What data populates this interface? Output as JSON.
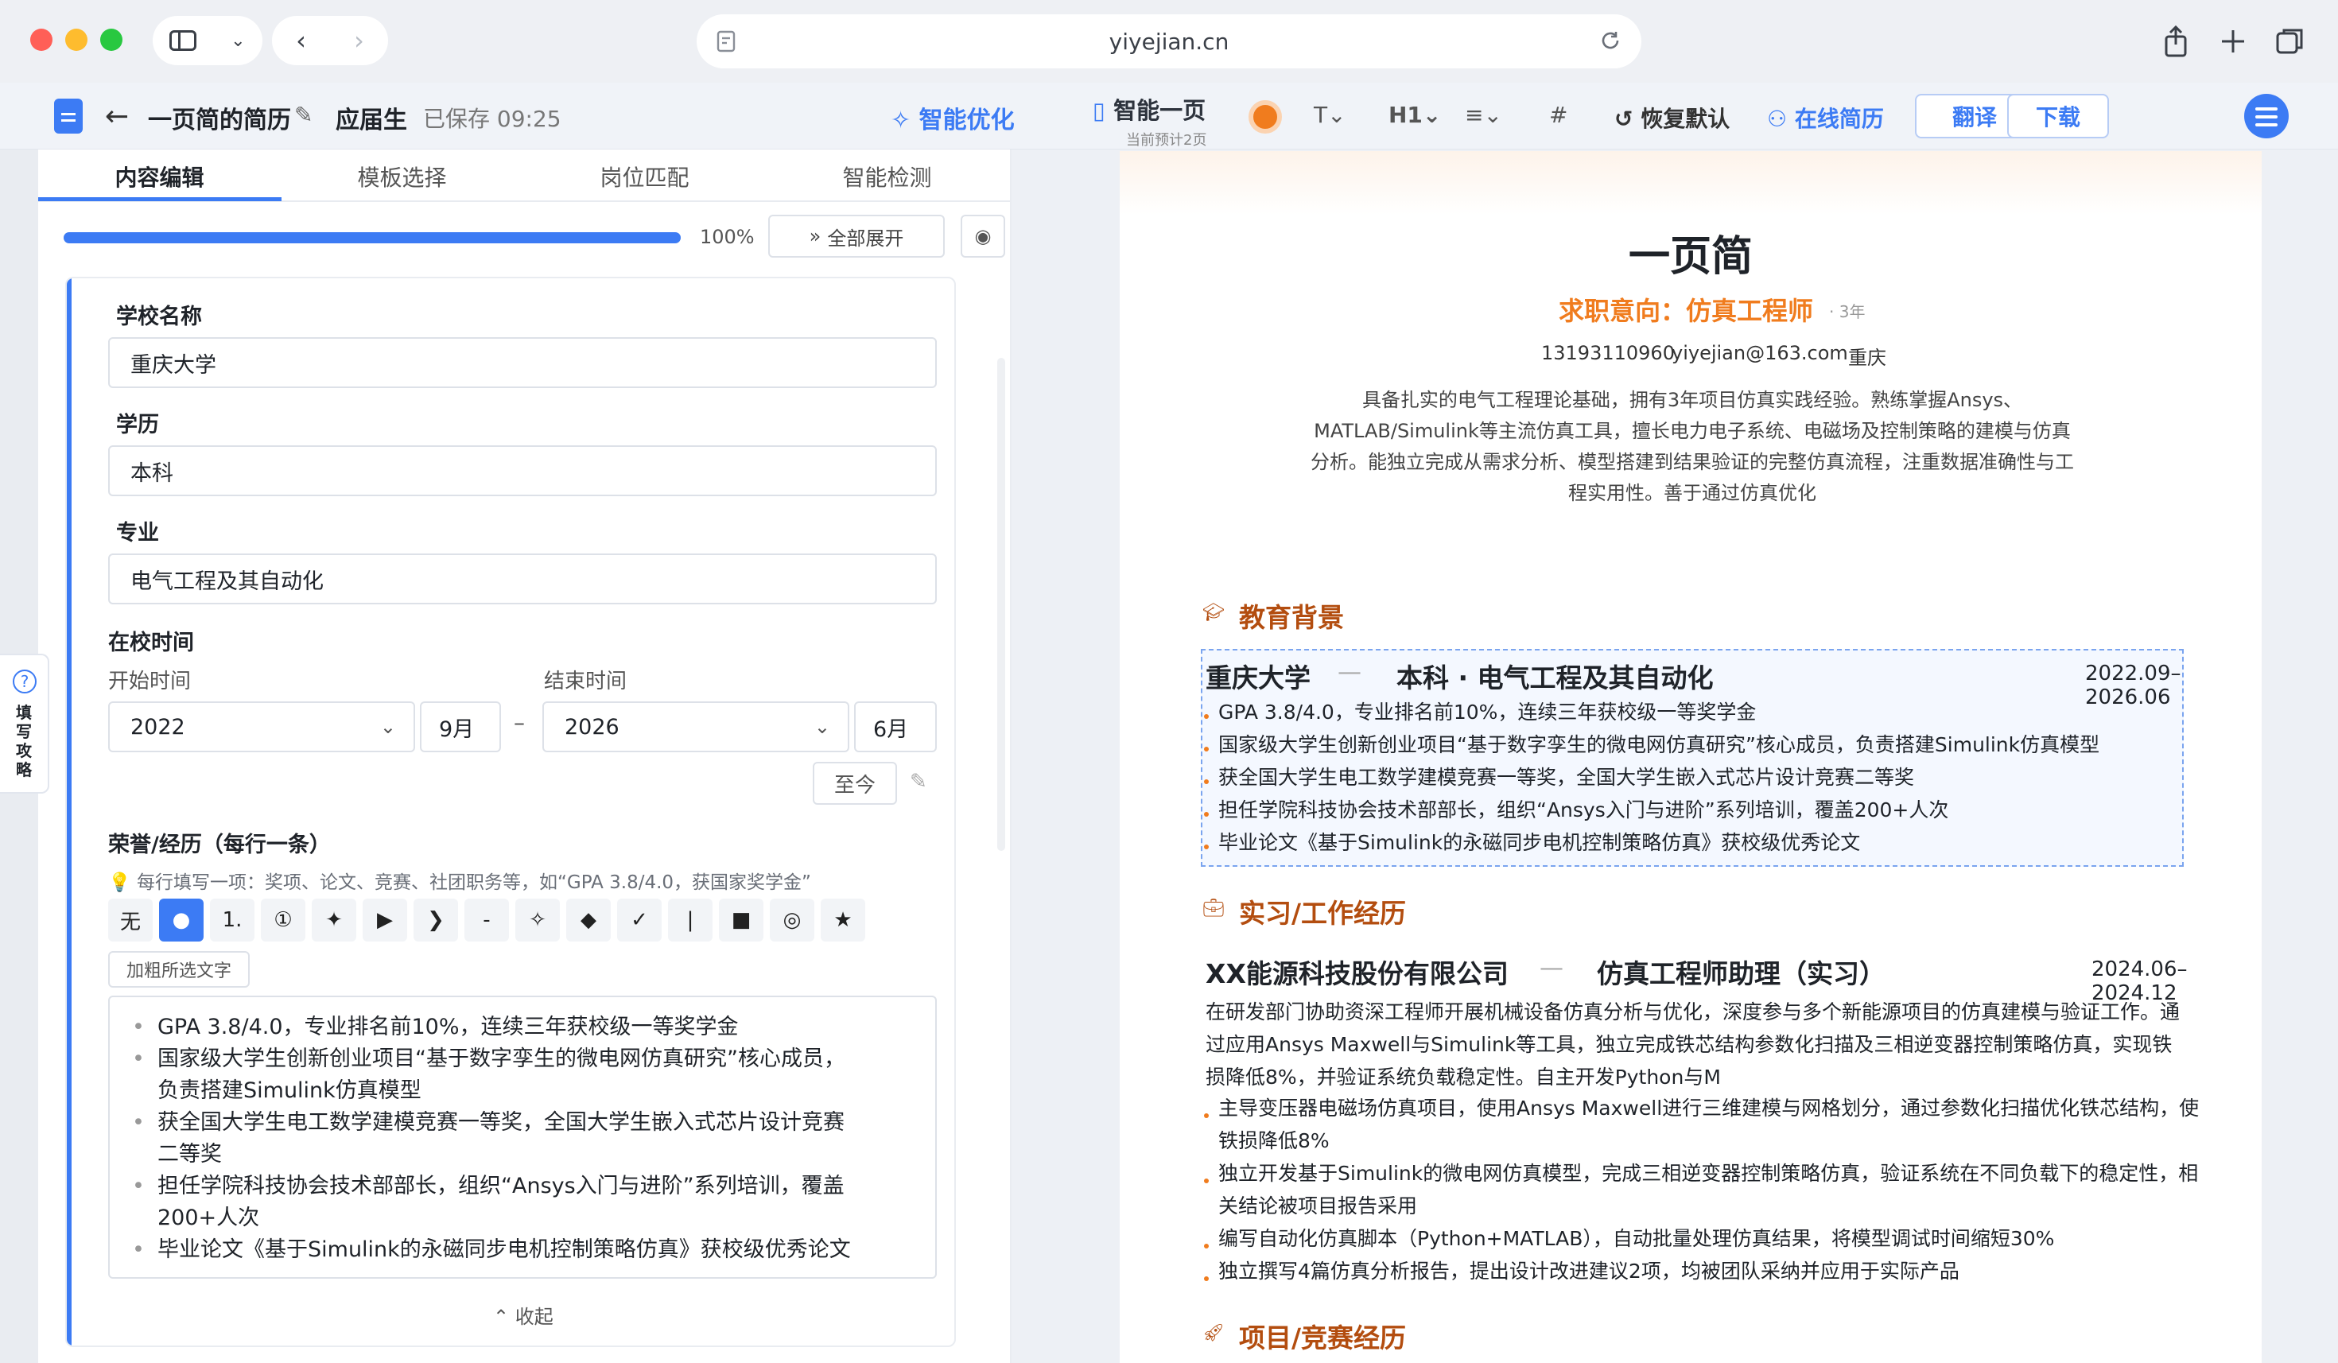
{
  "browser": {
    "url": "yiyejian.cn"
  },
  "header": {
    "title": "一页简的简历",
    "role": "应届生",
    "saved": "已保存 09:25",
    "smart_optimize": "智能优化",
    "smart_one_page": "智能一页",
    "page_estimate": "当前预计2页",
    "reset": "恢复默认",
    "online_resume": "在线简历",
    "translate": "翻译",
    "download": "下载"
  },
  "tabs": [
    "内容编辑",
    "模板选择",
    "岗位匹配",
    "智能检测"
  ],
  "progress": {
    "value": 100,
    "label": "100%"
  },
  "expand_all": "全部展开",
  "form": {
    "school_label": "学校名称",
    "school": "重庆大学",
    "degree_label": "学历",
    "degree": "本科",
    "major_label": "专业",
    "major": "电气工程及其自动化",
    "period_label": "在校时间",
    "start_label": "开始时间",
    "end_label": "结束时间",
    "start_year": "2022",
    "start_month": "9月",
    "end_year": "2026",
    "end_month": "6月",
    "range_dash": "–",
    "to_now": "至今",
    "honors_label": "荣誉/经历（每行一条）",
    "hint": "每行填写一项：奖项、论文、竞赛、社团职务等，如“GPA 3.8/4.0，获国家奖学金”",
    "bold_button": "加粗所选文字",
    "collapse": "收起"
  },
  "bullet_styles": [
    "无",
    "●",
    "1.",
    "①",
    "✦",
    "▶",
    "❯",
    "-",
    "✧",
    "◆",
    "✓",
    "|",
    "■",
    "◎",
    "★"
  ],
  "honors_text": [
    {
      "first": "GPA 3.8/4.0，专业排名前10%，连续三年获校级一等奖学金",
      "cont": ""
    },
    {
      "first": "国家级大学生创新创业项目“基于数字孪生的微电网仿真研究”核心成员，",
      "cont": "负责搭建Simulink仿真模型"
    },
    {
      "first": "获全国大学生电工数学建模竞赛一等奖，全国大学生嵌入式芯片设计竞赛",
      "cont": "二等奖"
    },
    {
      "first": "担任学院科技协会技术部部长，组织“Ansys入门与进阶”系列培训，覆盖",
      "cont": "200+人次"
    },
    {
      "first": "毕业论文《基于Simulink的永磁同步电机控制策略仿真》获校级优秀论文",
      "cont": ""
    }
  ],
  "guide": "填写攻略",
  "resume": {
    "name": "一页简",
    "intent": "求职意向：仿真工程师",
    "years": "· 3年",
    "phone": "13193110960",
    "email": "yiyejian@163.com",
    "city": "重庆",
    "summary": "具备扎实的电气工程理论基础，拥有3年项目仿真实践经验。熟练掌握Ansys、MATLAB/Simulink等主流仿真工具，擅长电力电子系统、电磁场及控制策略的建模与仿真分析。能独立完成从需求分析、模型搭建到结果验证的完整仿真流程，注重数据准确性与工程实用性。善于通过仿真优化",
    "education_title": "教育背景",
    "edu_school": "重庆大学",
    "edu_degree": "本科 · 电气工程及其自动化",
    "edu_date": "2022.09–2026.06",
    "edu_items": [
      "GPA 3.8/4.0，专业排名前10%，连续三年获校级一等奖学金",
      "国家级大学生创新创业项目“基于数字孪生的微电网仿真研究”核心成员，负责搭建Simulink仿真模型",
      "获全国大学生电工数学建模竞赛一等奖，全国大学生嵌入式芯片设计竞赛二等奖",
      "担任学院科技协会技术部部长，组织“Ansys入门与进阶”系列培训，覆盖200+人次",
      "毕业论文《基于Simulink的永磁同步电机控制策略仿真》获校级优秀论文"
    ],
    "work_title": "实习/工作经历",
    "work_company": "XX能源科技股份有限公司",
    "work_role": "仿真工程师助理（实习）",
    "work_date": "2024.06–2024.12",
    "work_desc": "在研发部门协助资深工程师开展机械设备仿真分析与优化，深度参与多个新能源项目的仿真建模与验证工作。通过应用Ansys Maxwell与Simulink等工具，独立完成铁芯结构参数化扫描及三相逆变器控制策略仿真，实现铁损降低8%，并验证系统负载稳定性。自主开发Python与M",
    "work_items": [
      {
        "l1": "主导变压器电磁场仿真项目，使用Ansys Maxwell进行三维建模与网格划分，通过参数化扫描优化铁芯结构，使",
        "l2": "铁损降低8%"
      },
      {
        "l1": "独立开发基于Simulink的微电网仿真模型，完成三相逆变器控制策略仿真，验证系统在不同负载下的稳定性，相",
        "l2": "关结论被项目报告采用"
      },
      {
        "l1": "编写自动化仿真脚本（Python+MATLAB），自动批量处理仿真结果，将模型调试时间缩短30%",
        "l2": ""
      },
      {
        "l1": "独立撰写4篇仿真分析报告，提出设计改进建议2项，均被团队采纳并应用于实际产品",
        "l2": ""
      }
    ],
    "project_title": "项目/竞赛经历"
  },
  "colors": {
    "accent": "#3c7bf4",
    "orange": "#f07c1e",
    "section": "#b34d0f"
  }
}
